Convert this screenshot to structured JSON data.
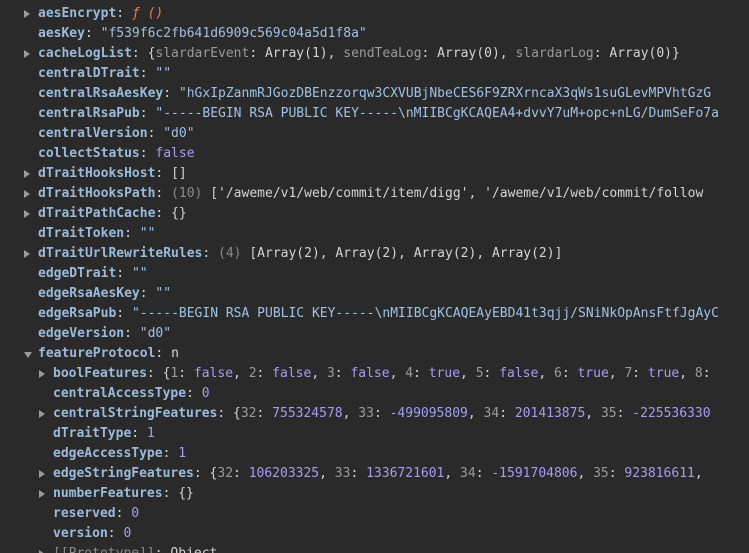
{
  "rows": [
    {
      "key": "aesEncrypt",
      "parts": [
        [
          "f",
          "ƒ ()"
        ]
      ]
    },
    {
      "key": "aesKey",
      "parts": [
        [
          "s",
          "\"f539f6c2fb641d6909c569c04a5d1f8a\""
        ]
      ]
    },
    {
      "key": "cacheLogList",
      "parts": [
        [
          "p",
          "{"
        ],
        [
          "ek",
          "slardarEvent"
        ],
        [
          "p",
          ": Array(1), "
        ],
        [
          "ek",
          "sendTeaLog"
        ],
        [
          "p",
          ": Array(0), "
        ],
        [
          "ek",
          "slardarLog"
        ],
        [
          "p",
          ": Array(0)}"
        ]
      ]
    },
    {
      "key": "centralDTrait",
      "parts": [
        [
          "s",
          "\"\""
        ]
      ]
    },
    {
      "key": "centralRsaAesKey",
      "parts": [
        [
          "s",
          "\"hGxIpZanmRJGozDBEnzzorqw3CXVUBjNbeCES6F9ZRXrncaX3qWs1suGLevMPVhtGzG"
        ]
      ]
    },
    {
      "key": "centralRsaPub",
      "parts": [
        [
          "s",
          "\"-----BEGIN RSA PUBLIC KEY-----\\nMIIBCgKCAQEA4+dvvY7uM+opc+nLG/DumSeFo7a"
        ]
      ]
    },
    {
      "key": "centralVersion",
      "parts": [
        [
          "s",
          "\"d0\""
        ]
      ]
    },
    {
      "key": "collectStatus",
      "parts": [
        [
          "b",
          "false"
        ]
      ]
    },
    {
      "key": "dTraitHooksHost",
      "parts": [
        [
          "p",
          "[]"
        ]
      ]
    },
    {
      "key": "dTraitHooksPath",
      "parts": [
        [
          "g",
          "(10)"
        ],
        [
          "p",
          "  ['/aweme/v1/web/commit/item/digg', '/aweme/v1/web/commit/follow"
        ]
      ]
    },
    {
      "key": "dTraitPathCache",
      "parts": [
        [
          "p",
          "{}"
        ]
      ]
    },
    {
      "key": "dTraitToken",
      "parts": [
        [
          "s",
          "\"\""
        ]
      ]
    },
    {
      "key": "dTraitUrlRewriteRules",
      "parts": [
        [
          "g",
          "(4)"
        ],
        [
          "p",
          "  [Array(2), Array(2), Array(2), Array(2)]"
        ]
      ]
    },
    {
      "key": "edgeDTrait",
      "parts": [
        [
          "s",
          "\"\""
        ]
      ]
    },
    {
      "key": "edgeRsaAesKey",
      "parts": [
        [
          "s",
          "\"\""
        ]
      ]
    },
    {
      "key": "edgeRsaPub",
      "parts": [
        [
          "s",
          "\"-----BEGIN RSA PUBLIC KEY-----\\nMIIBCgKCAQEAyEBD41t3qjj/SNiNkOpAnsFtfJgAyC"
        ]
      ]
    },
    {
      "key": "edgeVersion",
      "parts": [
        [
          "s",
          "\"d0\""
        ]
      ]
    },
    {
      "key": "featureProtocol",
      "parts": [
        [
          "p",
          "n"
        ]
      ]
    },
    {
      "key": "boolFeatures",
      "parts": [
        [
          "p",
          "{"
        ],
        [
          "ek",
          "1"
        ],
        [
          "p",
          ": "
        ],
        [
          "b",
          "false"
        ],
        [
          "p",
          ", "
        ],
        [
          "ek",
          "2"
        ],
        [
          "p",
          ": "
        ],
        [
          "b",
          "false"
        ],
        [
          "p",
          ", "
        ],
        [
          "ek",
          "3"
        ],
        [
          "p",
          ": "
        ],
        [
          "b",
          "false"
        ],
        [
          "p",
          ", "
        ],
        [
          "ek",
          "4"
        ],
        [
          "p",
          ": "
        ],
        [
          "b",
          "true"
        ],
        [
          "p",
          ", "
        ],
        [
          "ek",
          "5"
        ],
        [
          "p",
          ": "
        ],
        [
          "b",
          "false"
        ],
        [
          "p",
          ", "
        ],
        [
          "ek",
          "6"
        ],
        [
          "p",
          ": "
        ],
        [
          "b",
          "true"
        ],
        [
          "p",
          ", "
        ],
        [
          "ek",
          "7"
        ],
        [
          "p",
          ": "
        ],
        [
          "b",
          "true"
        ],
        [
          "p",
          ", "
        ],
        [
          "ek",
          "8"
        ],
        [
          "p",
          ": "
        ]
      ]
    },
    {
      "key": "centralAccessType",
      "parts": [
        [
          "n",
          "0"
        ]
      ]
    },
    {
      "key": "centralStringFeatures",
      "parts": [
        [
          "p",
          "{"
        ],
        [
          "ek",
          "32"
        ],
        [
          "p",
          ": "
        ],
        [
          "n",
          "755324578"
        ],
        [
          "p",
          ", "
        ],
        [
          "ek",
          "33"
        ],
        [
          "p",
          ": "
        ],
        [
          "n",
          "-499095809"
        ],
        [
          "p",
          ", "
        ],
        [
          "ek",
          "34"
        ],
        [
          "p",
          ": "
        ],
        [
          "n",
          "201413875"
        ],
        [
          "p",
          ", "
        ],
        [
          "ek",
          "35"
        ],
        [
          "p",
          ": "
        ],
        [
          "n",
          "-225536330"
        ]
      ]
    },
    {
      "key": "dTraitType",
      "parts": [
        [
          "n",
          "1"
        ]
      ]
    },
    {
      "key": "edgeAccessType",
      "parts": [
        [
          "n",
          "1"
        ]
      ]
    },
    {
      "key": "edgeStringFeatures",
      "parts": [
        [
          "p",
          "{"
        ],
        [
          "ek",
          "32"
        ],
        [
          "p",
          ": "
        ],
        [
          "n",
          "106203325"
        ],
        [
          "p",
          ", "
        ],
        [
          "ek",
          "33"
        ],
        [
          "p",
          ": "
        ],
        [
          "n",
          "1336721601"
        ],
        [
          "p",
          ", "
        ],
        [
          "ek",
          "34"
        ],
        [
          "p",
          ": "
        ],
        [
          "n",
          "-1591704806"
        ],
        [
          "p",
          ", "
        ],
        [
          "ek",
          "35"
        ],
        [
          "p",
          ": "
        ],
        [
          "n",
          "923816611"
        ],
        [
          "p",
          ", "
        ]
      ]
    },
    {
      "key": "numberFeatures",
      "parts": [
        [
          "p",
          "{}"
        ]
      ]
    },
    {
      "key": "reserved",
      "parts": [
        [
          "n",
          "0"
        ]
      ]
    },
    {
      "key": "version",
      "parts": [
        [
          "n",
          "0"
        ]
      ]
    },
    {
      "key": "[[Prototype]]",
      "parts": [
        [
          "p",
          ": Object"
        ]
      ]
    }
  ]
}
